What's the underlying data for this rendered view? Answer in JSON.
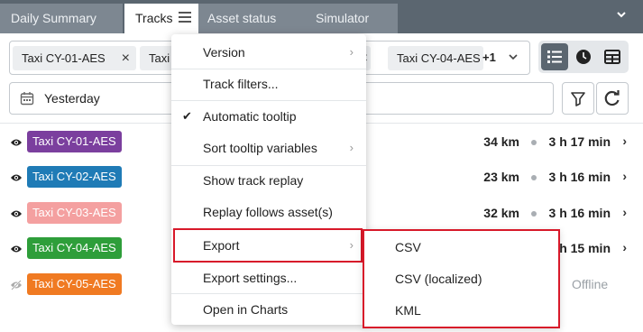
{
  "tabs": [
    {
      "label": "Daily Summary"
    },
    {
      "label": "Tracks"
    },
    {
      "label": "Asset status"
    },
    {
      "label": "Simulator"
    }
  ],
  "assets": {
    "chips": [
      "Taxi CY-01-AES",
      "Taxi",
      "",
      "Taxi CY-04-AES"
    ],
    "more": "+1"
  },
  "date": {
    "value": "Yesterday"
  },
  "tracks": [
    {
      "label": "Taxi CY-01-AES",
      "color": "#7b3f9e",
      "distance": "34 km",
      "duration": "3 h 17 min",
      "visible": true
    },
    {
      "label": "Taxi CY-02-AES",
      "color": "#1f7bb6",
      "distance": "23 km",
      "duration": "3 h 16 min",
      "visible": true
    },
    {
      "label": "Taxi CY-03-AES",
      "color": "#f4a0a0",
      "distance": "32 km",
      "duration": "3 h 16 min",
      "visible": true
    },
    {
      "label": "Taxi CY-04-AES",
      "color": "#2e9e3a",
      "distance": "",
      "duration": "h 15 min",
      "visible": true
    },
    {
      "label": "Taxi CY-05-AES",
      "color": "#f07a22",
      "distance": "",
      "duration": "",
      "status": "Offline",
      "visible": false
    }
  ],
  "menu": {
    "items": [
      {
        "label": "Version",
        "submenu": true
      },
      {
        "label": "Track filters..."
      },
      {
        "label": "Automatic tooltip",
        "checked": true
      },
      {
        "label": "Sort tooltip variables",
        "submenu": true
      },
      {
        "label": "Show track replay"
      },
      {
        "label": "Replay follows asset(s)"
      },
      {
        "label": "Export",
        "submenu": true
      },
      {
        "label": "Export settings..."
      },
      {
        "label": "Open in Charts"
      }
    ],
    "arrow": "›",
    "check": "✔"
  },
  "export_submenu": {
    "items": [
      "CSV",
      "CSV (localized)",
      "KML"
    ]
  },
  "icons": {
    "close": "×",
    "caret_down": "⌄",
    "chevron_right": "›"
  },
  "colors": {
    "highlight": "#d8192a",
    "tabbar": "#5b6670"
  }
}
